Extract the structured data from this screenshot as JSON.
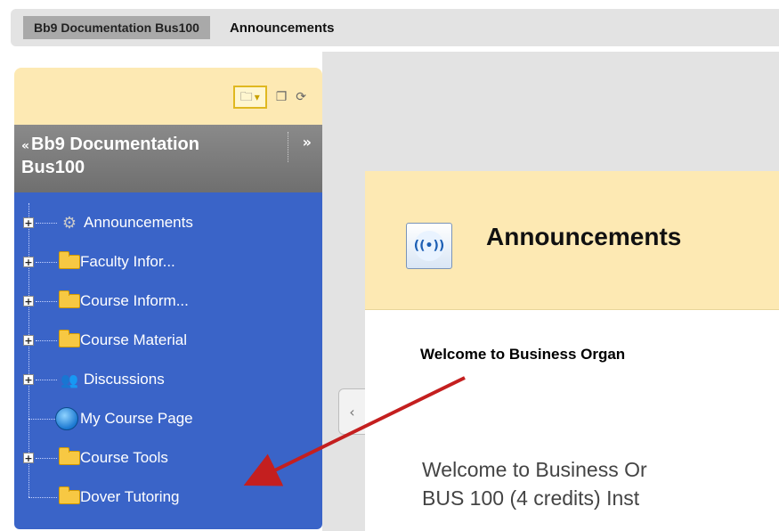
{
  "breadcrumb": {
    "course": "Bb9 Documentation Bus100",
    "current": "Announcements"
  },
  "toolbar": {
    "icons": [
      "folder-view-icon",
      "chevron-down-icon",
      "window-icon",
      "refresh-icon"
    ]
  },
  "course_menu": {
    "title_line1": "Bb9 Documentation",
    "title_line2": "Bus100",
    "collapse_glyph": "«",
    "expand_glyph": "»",
    "items": [
      {
        "label": "Announcements",
        "icon": "gear-icon",
        "expandable": true
      },
      {
        "label": "Faculty Infor...",
        "icon": "folder-icon",
        "expandable": true
      },
      {
        "label": "Course Inform...",
        "icon": "folder-icon",
        "expandable": true
      },
      {
        "label": "Course Material",
        "icon": "folder-icon",
        "expandable": true
      },
      {
        "label": "Discussions",
        "icon": "people-icon",
        "expandable": true
      },
      {
        "label": "My Course Page",
        "icon": "globe-icon",
        "expandable": false
      },
      {
        "label": "Course Tools",
        "icon": "folder-icon",
        "expandable": true
      },
      {
        "label": "Dover Tutoring",
        "icon": "folder-icon",
        "expandable": false
      }
    ]
  },
  "content": {
    "title": "Announcements",
    "welcome_heading": "Welcome to Business Organ",
    "body_line1": "Welcome to Business Or",
    "body_line2": "BUS 100 (4 credits)  Inst"
  },
  "colors": {
    "menu_bg": "#3a64c8",
    "header_bg": "#fde9b3",
    "arrow": "#c41f1f"
  }
}
